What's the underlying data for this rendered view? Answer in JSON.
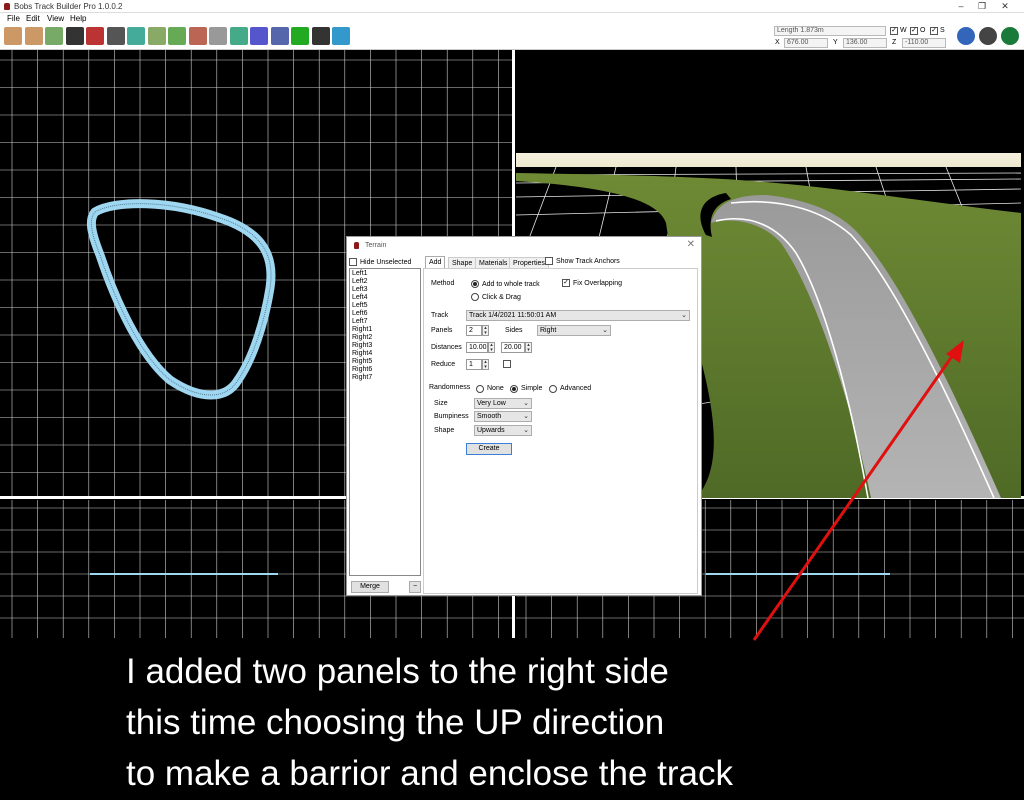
{
  "window": {
    "title": "Bobs Track Builder Pro 1.0.0.2"
  },
  "menu": [
    "File",
    "Edit",
    "View",
    "Help"
  ],
  "toolbar": {
    "tools": [
      {
        "icon": "spline-tool-icon",
        "color": "#c96"
      },
      {
        "icon": "spline-edit-icon",
        "color": "#c96"
      },
      {
        "icon": "terrain-map-icon",
        "color": "#7a6"
      },
      {
        "icon": "sun-sky-icon",
        "color": "#333"
      },
      {
        "icon": "wall-icon",
        "color": "#b33"
      },
      {
        "icon": "road-sign-icon",
        "color": "#555"
      },
      {
        "icon": "spline-curve-icon",
        "color": "#4a9"
      },
      {
        "icon": "grid-surface-icon",
        "color": "#8a6"
      },
      {
        "icon": "grass-texture-icon",
        "color": "#6a5"
      },
      {
        "icon": "brick-texture-icon",
        "color": "#b65"
      },
      {
        "icon": "stone-wall-icon",
        "color": "#999"
      },
      {
        "icon": "mountain-terrain-icon",
        "color": "#4a8"
      },
      {
        "icon": "shapes-objects-icon",
        "color": "#55c"
      },
      {
        "icon": "paint-brush-icon",
        "color": "#56a"
      },
      {
        "icon": "checkered-flag-icon",
        "color": "#2a2"
      },
      {
        "icon": "camera-icon",
        "color": "#333"
      },
      {
        "icon": "water-icon",
        "color": "#39c"
      }
    ],
    "right_tools": [
      {
        "icon": "helicopter-icon",
        "color": "#36b"
      },
      {
        "icon": "steering-wheel-icon",
        "color": "#444"
      },
      {
        "icon": "walk-mode-icon",
        "color": "#1a7a3a"
      }
    ]
  },
  "readouts": {
    "length": "Length 1.873m",
    "x_label": "X",
    "x_value": "676.00",
    "y_label": "Y",
    "y_value": "136.00",
    "z_label": "Z",
    "z_value": "-110.00",
    "w_label": "W",
    "o_label": "O",
    "s_label": "S"
  },
  "dialog": {
    "title": "Terrain",
    "hide_unselected": "Hide Unselected",
    "sides": [
      "Left1",
      "Left2",
      "Left3",
      "Left4",
      "Left5",
      "Left6",
      "Left7",
      "Right1",
      "Right2",
      "Right3",
      "Right4",
      "Right5",
      "Right6",
      "Right7"
    ],
    "tabs": [
      "Add",
      "Shape",
      "Materials",
      "Properties"
    ],
    "show_anchors": "Show Track Anchors",
    "method_label": "Method",
    "method_whole": "Add to whole track",
    "method_click": "Click & Drag",
    "fix_overlapping": "Fix Overlapping",
    "track_label": "Track",
    "track_value": "Track 1/4/2021 11:50:01 AM",
    "panels_label": "Panels",
    "panels_value": "2",
    "sides_label": "Sides",
    "sides_value": "Right",
    "distances_label": "Distances",
    "distance_1": "10.00",
    "distance_2": "20.00",
    "reduce_label": "Reduce",
    "reduce_value": "1",
    "randomness_label": "Randomness",
    "rand_none": "None",
    "rand_simple": "Simple",
    "rand_advanced": "Advanced",
    "size_label": "Size",
    "size_value": "Very Low",
    "bumpiness_label": "Bumpiness",
    "bumpiness_value": "Smooth",
    "shape_label": "Shape",
    "shape_value": "Upwards",
    "create_button": "Create",
    "merge_button": "Merge",
    "minus_button": "−"
  },
  "caption": {
    "line1": "I added two panels to the right side",
    "line2": "this time choosing the UP direction",
    "line3": "to make a barrior and enclose the track"
  },
  "colors": {
    "annotation_arrow": "#e01010",
    "track_outline": "#9fd6f0"
  }
}
